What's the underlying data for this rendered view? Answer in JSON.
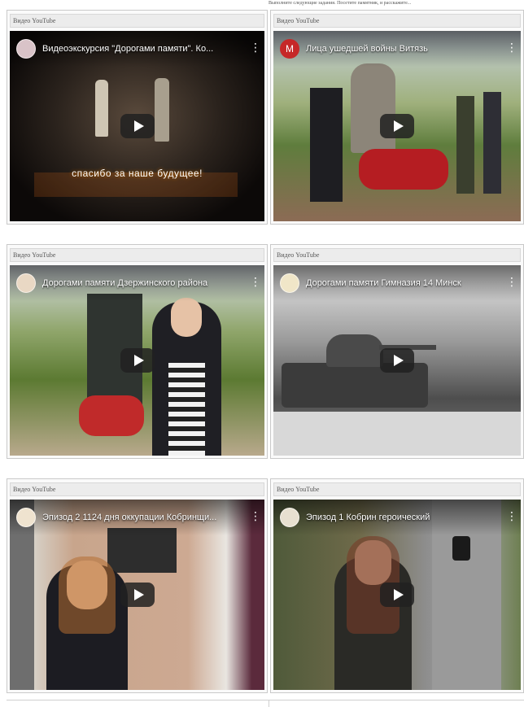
{
  "page": {
    "top_note": "Выполните следующие задания. Посетите памятник, и расскажите...",
    "youtube_label": "Видео YouTube"
  },
  "videos": [
    {
      "title": "Видеоэкскурсия \"Дорогами памяти\". Ко...",
      "avatar": "",
      "caption": "спасибо за наше будущее!"
    },
    {
      "title": "Лица ушедшей войны Витязь",
      "avatar": "М",
      "caption": ""
    },
    {
      "title": "Дорогами памяти Дзержинского района",
      "avatar": "",
      "caption": ""
    },
    {
      "title": "Дорогами памяти Гимназия 14 Минск",
      "avatar": "",
      "caption": ""
    },
    {
      "title": "Эпизод 2 1124 дня оккупации Кобринщи...",
      "avatar": "",
      "caption": ""
    },
    {
      "title": "Эпизод 1 Кобрин героический",
      "avatar": "",
      "caption": ""
    }
  ],
  "colors": {
    "avatar_red": "#c62828",
    "header_bg": "#ececec"
  },
  "icons": {
    "menu": "vertical-dots-icon",
    "play": "play-icon"
  }
}
